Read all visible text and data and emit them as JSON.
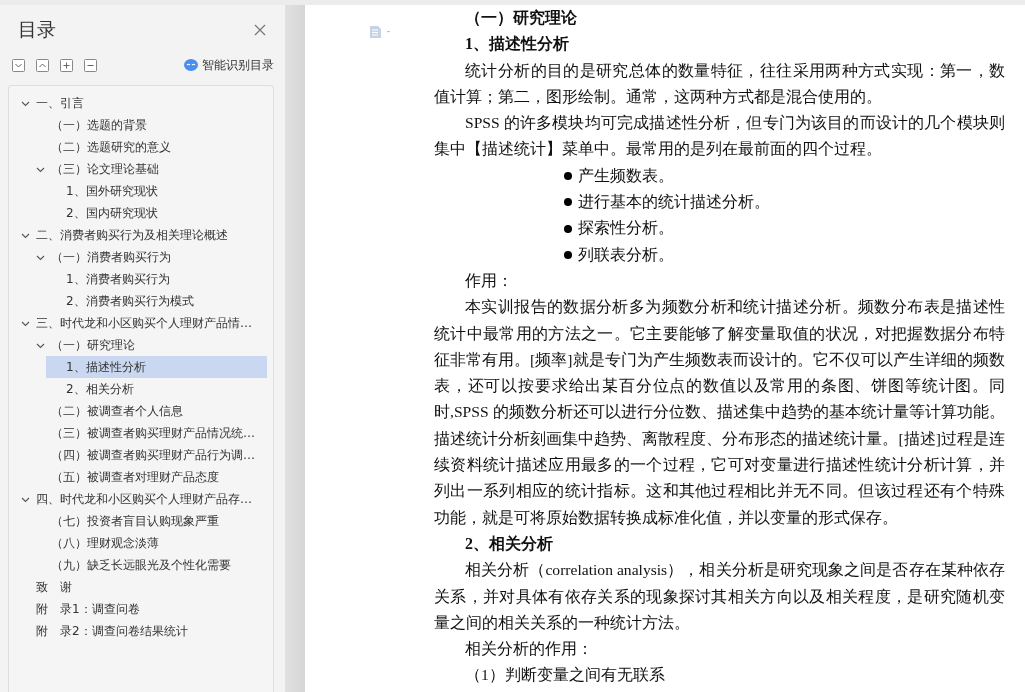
{
  "sidebar": {
    "title": "目录",
    "smart_button": "智能识别目录",
    "outline": [
      {
        "title": "一、引言",
        "expanded": true,
        "selected": false,
        "children": [
          {
            "title": "（一）选题的背景",
            "selected": false
          },
          {
            "title": "（二）选题研究的意义",
            "selected": false
          },
          {
            "title": "（三）论文理论基础",
            "expanded": true,
            "selected": false,
            "children": [
              {
                "title": "1、国外研究现状",
                "selected": false
              },
              {
                "title": "2、国内研究现状",
                "selected": false
              }
            ]
          }
        ]
      },
      {
        "title": "二、消费者购买行为及相关理论概述",
        "expanded": true,
        "selected": false,
        "children": [
          {
            "title": "（一）消费者购买行为",
            "expanded": true,
            "selected": false,
            "children": [
              {
                "title": "1、消费者购买行为",
                "selected": false
              },
              {
                "title": "2、消费者购买行为模式",
                "selected": false
              }
            ]
          }
        ]
      },
      {
        "title": "三、时代龙和小区购买个人理财产品情…",
        "expanded": true,
        "selected": false,
        "children": [
          {
            "title": "（一）研究理论",
            "expanded": true,
            "selected": false,
            "children": [
              {
                "title": "1、描述性分析",
                "selected": true
              },
              {
                "title": "2、相关分析",
                "selected": false
              }
            ]
          },
          {
            "title": "（二）被调查者个人信息",
            "selected": false
          },
          {
            "title": "（三）被调查者购买理财产品情况统…",
            "selected": false
          },
          {
            "title": "（四）被调查者购买理财产品行为调…",
            "selected": false
          },
          {
            "title": "（五）被调查者对理财产品态度",
            "selected": false
          }
        ]
      },
      {
        "title": "四、时代龙和小区购买个人理财产品存…",
        "expanded": true,
        "selected": false,
        "children": [
          {
            "title": "（七）投资者盲目认购现象严重",
            "selected": false
          },
          {
            "title": "（八）理财观念淡薄",
            "selected": false
          },
          {
            "title": "（九）缺乏长远眼光及个性化需要",
            "selected": false
          }
        ]
      },
      {
        "title": "致　谢",
        "selected": false
      },
      {
        "title": "附　录1：调查问卷",
        "selected": false
      },
      {
        "title": "附　录2：调查问卷结果统计",
        "selected": false
      }
    ]
  },
  "document": {
    "blocks": [
      {
        "kind": "heading",
        "text": "（一）研究理论"
      },
      {
        "kind": "heading",
        "text": "1、描述性分析"
      },
      {
        "kind": "para",
        "text": " 统计分析的目的是研究总体的数量特征，往往采用两种方式实现：第一，数值计算；第二，图形绘制。通常，这两种方式都是混合使用的。"
      },
      {
        "kind": "para",
        "text": "SPSS 的许多模块均可完成描述性分析，但专门为该目的而设计的几个模块则集中【描述统计】菜单中。最常用的是列在最前面的四个过程。"
      },
      {
        "kind": "bullet",
        "text": "产生频数表。"
      },
      {
        "kind": "bullet",
        "text": "进行基本的统计描述分析。"
      },
      {
        "kind": "bullet",
        "text": "探索性分析。"
      },
      {
        "kind": "bullet",
        "text": "列联表分析。"
      },
      {
        "kind": "para",
        "text": "作用："
      },
      {
        "kind": "para",
        "text": "本实训报告的数据分析多为频数分析和统计描述分析。频数分布表是描述性统计中最常用的方法之一。它主要能够了解变量取值的状况，对把握数据分布特征非常有用。[频率]就是专门为产生频数表而设计的。它不仅可以产生详细的频数表，还可以按要求给出某百分位点的数值以及常用的条图、饼图等统计图。同时,SPSS 的频数分析还可以进行分位数、描述集中趋势的基本统计量等计算功能。描述统计分析刻画集中趋势、离散程度、分布形态的描述统计量。[描述]过程是连续资料统计描述应用最多的一个过程，它可对变量进行描述性统计分析计算，并列出一系列相应的统计指标。这和其他过程相比并无不同。但该过程还有个特殊功能，就是可将原始数据转换成标准化值，并以变量的形式保存。"
      },
      {
        "kind": "heading",
        "text": "2、相关分析"
      },
      {
        "kind": "para",
        "text": "相关分析（correlation analysis），相关分析是研究现象之间是否存在某种依存关系，并对具体有依存关系的现象探讨其相关方向以及相关程度，是研究随机变量之间的相关关系的一种统计方法。"
      },
      {
        "kind": "para",
        "text": "相关分析的作用："
      },
      {
        "kind": "para",
        "text": "（1）判断变量之间有无联系"
      }
    ]
  }
}
